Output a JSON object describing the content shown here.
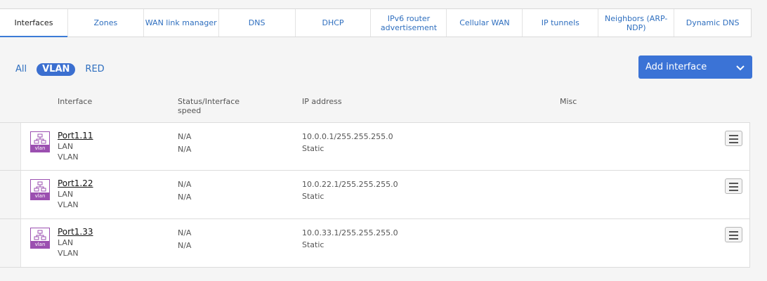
{
  "tabs": [
    {
      "label": "Interfaces",
      "active": true
    },
    {
      "label": "Zones"
    },
    {
      "label": "WAN link manager"
    },
    {
      "label": "DNS"
    },
    {
      "label": "DHCP"
    },
    {
      "label": "IPv6 router advertisement"
    },
    {
      "label": "Cellular WAN"
    },
    {
      "label": "IP tunnels"
    },
    {
      "label": "Neighbors (ARP-NDP)"
    },
    {
      "label": "Dynamic DNS"
    }
  ],
  "filters": [
    {
      "label": "All"
    },
    {
      "label": "VLAN",
      "active": true
    },
    {
      "label": "RED"
    }
  ],
  "add_button": {
    "label": "Add interface",
    "icon": "chevron-down-icon"
  },
  "columns": {
    "interface": "Interface",
    "status": "Status/Interface speed",
    "ip": "IP address",
    "misc": "Misc"
  },
  "rows": [
    {
      "name": "Port1.11",
      "zone": "LAN",
      "type": "VLAN",
      "status": "N/A",
      "speed": "N/A",
      "ip": "10.0.0.1/255.255.255.0",
      "ip_mode": "Static",
      "icon_label": "vlan"
    },
    {
      "name": "Port1.22",
      "zone": "LAN",
      "type": "VLAN",
      "status": "N/A",
      "speed": "N/A",
      "ip": "10.0.22.1/255.255.255.0",
      "ip_mode": "Static",
      "icon_label": "vlan"
    },
    {
      "name": "Port1.33",
      "zone": "LAN",
      "type": "VLAN",
      "status": "N/A",
      "speed": "N/A",
      "ip": "10.0.33.1/255.255.255.0",
      "ip_mode": "Static",
      "icon_label": "vlan"
    }
  ],
  "colors": {
    "accent": "#3b73d6",
    "vlan_icon": "#9b4fb0"
  }
}
